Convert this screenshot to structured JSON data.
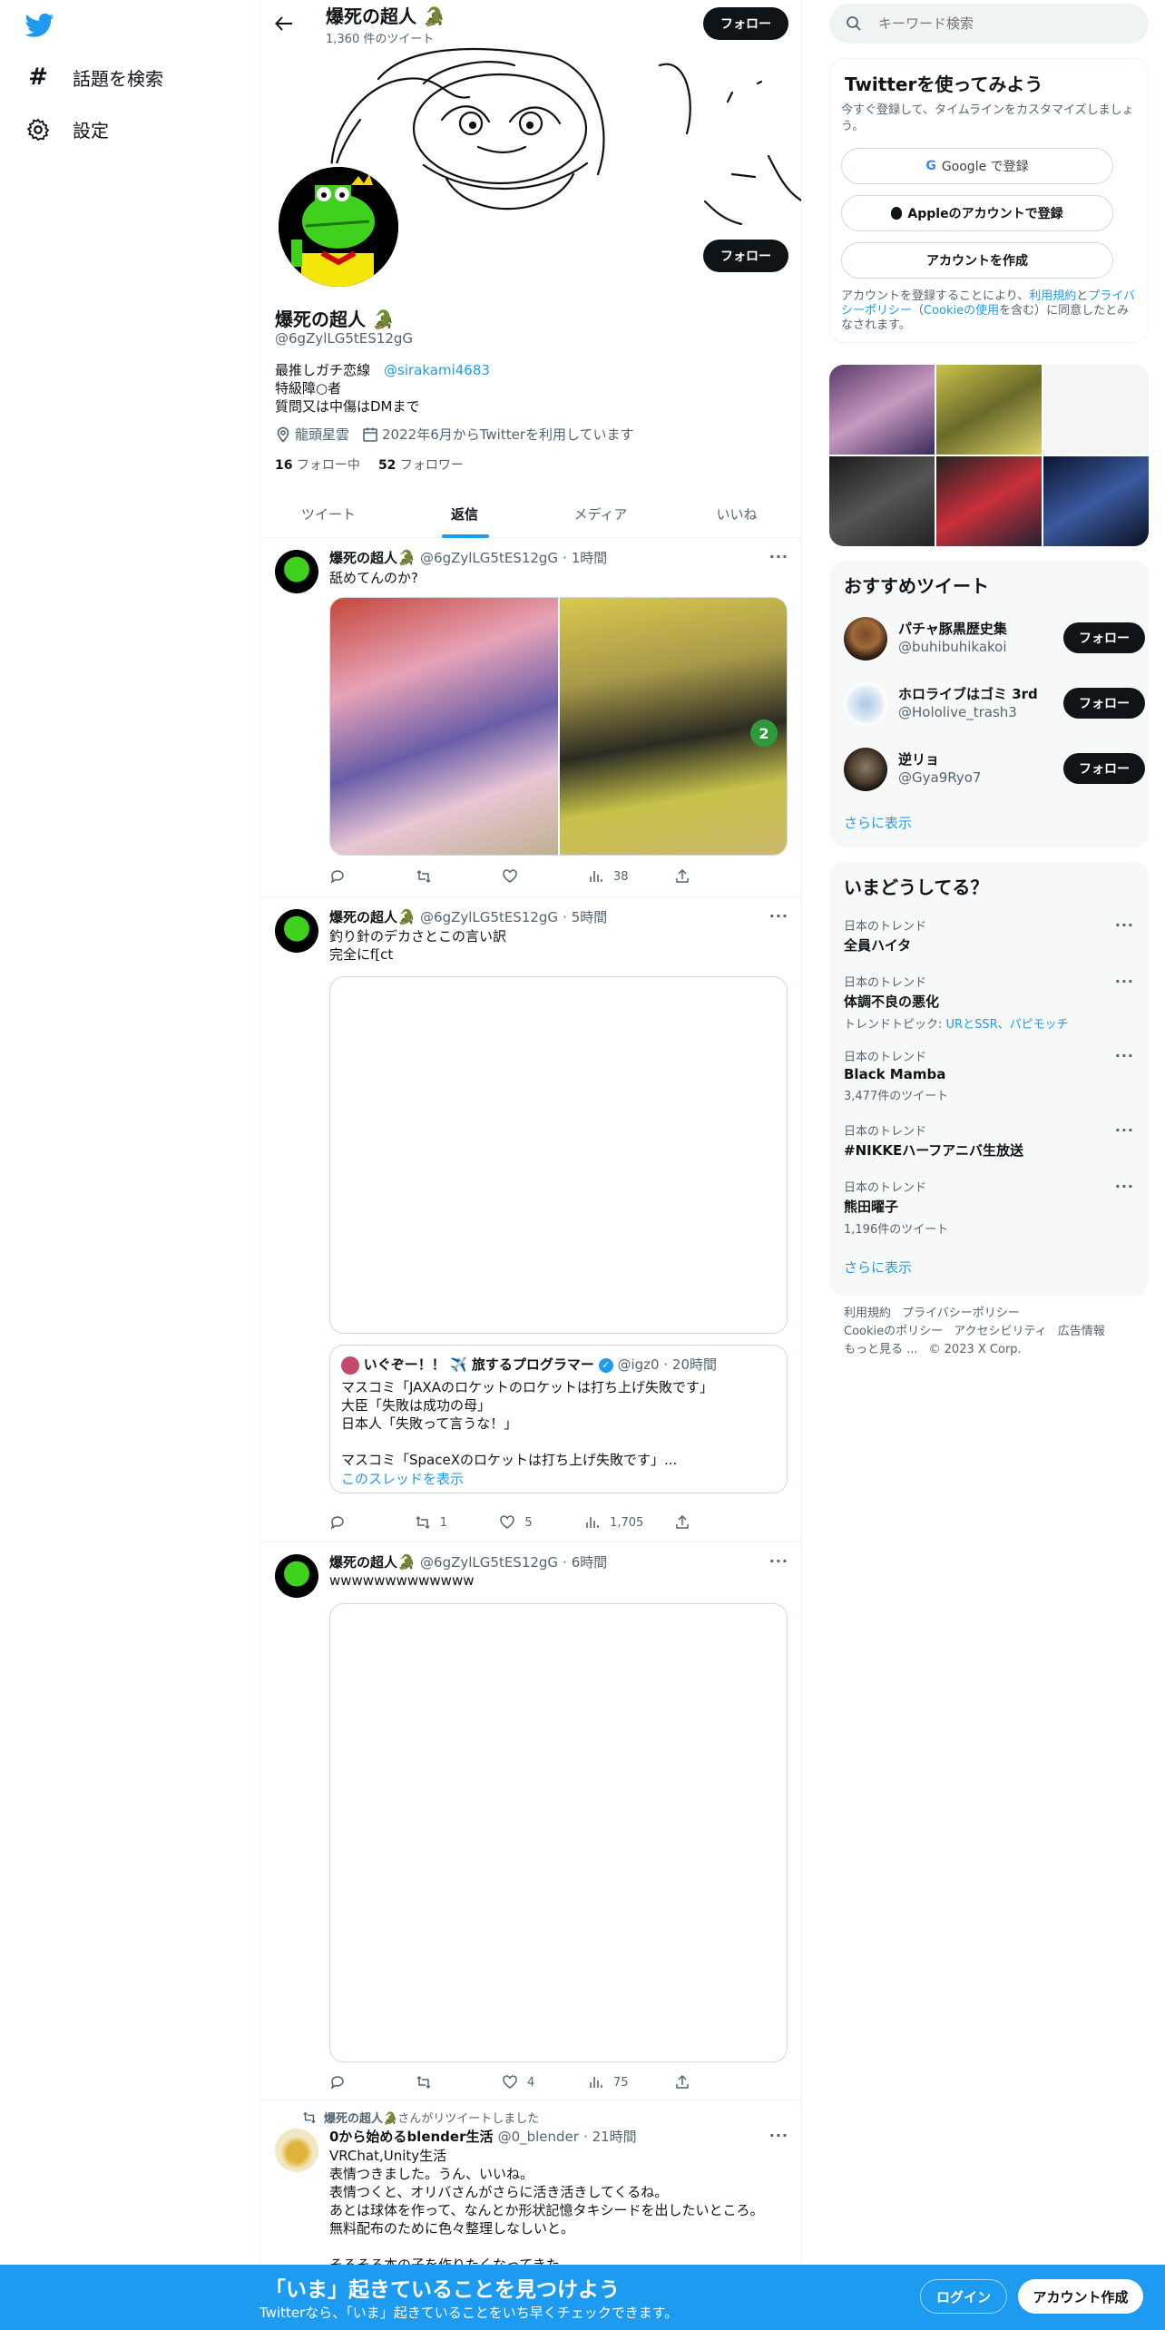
{
  "nav": {
    "search_label": "話題を検索",
    "settings_label": "設定"
  },
  "header": {
    "title": "爆死の超人",
    "tweet_count": "1,360 件のツイート",
    "follow_label": "フォロー"
  },
  "profile": {
    "name": "爆死の超人",
    "handle": "@6gZylLG5tES12gG",
    "follow_label": "フォロー",
    "bio_line1": "最推しガチ恋線",
    "bio_mention": "@sirakami4683",
    "bio_line2": "特級障○者",
    "bio_line3": "質問又は中傷はDMまで",
    "location": "龍頭星雲",
    "joined": "2022年6月からTwitterを利用しています",
    "following_count": "16",
    "following_label": "フォロー中",
    "followers_count": "52",
    "followers_label": "フォロワー"
  },
  "tabs": [
    {
      "label": "ツイート"
    },
    {
      "label": "返信"
    },
    {
      "label": "メディア"
    },
    {
      "label": "いいね"
    }
  ],
  "tweets": [
    {
      "name": "爆死の超人",
      "handle": "@6gZylLG5tES12gG",
      "time": "· 1時間",
      "text": "舐めてんのか?",
      "views": "38",
      "replies": "",
      "retweets": "",
      "likes": ""
    },
    {
      "name": "爆死の超人",
      "handle": "@6gZylLG5tES12gG",
      "time": "· 5時間",
      "text1": "釣り針のデカさとこの言い訳",
      "text2": "完全にf[ct",
      "quote": {
        "name": "いぐぞー！！ ✈️ 旅するプログラマー",
        "handle": "@igz0",
        "time": "· 20時間",
        "l1": "マスコミ「JAXAのロケットのロケットは打ち上げ失敗です」",
        "l2": "大臣「失敗は成功の母」",
        "l3": "日本人「失敗って言うな！」",
        "l4": "マスコミ「SpaceXのロケットは打ち上げ失敗です」...",
        "thread": "このスレッドを表示"
      },
      "retweets": "1",
      "likes": "5",
      "views": "1,705"
    },
    {
      "name": "爆死の超人",
      "handle": "@6gZylLG5tES12gG",
      "time": "· 6時間",
      "text": "wwwwwwwwwwwww",
      "likes": "4",
      "views": "75"
    },
    {
      "retweeted_by": "爆死の超人",
      "retweeted_suffix": "さんがリツイートしました",
      "name": "0から始めるblender生活",
      "handle": "@0_blender",
      "time": "· 21時間",
      "l1": "VRChat,Unity生活",
      "l2": "表情つきました。うん、いいね。",
      "l3": "表情つくと、オリバさんがさらに活き活きしてくるね。",
      "l4": "あとは球体を作って、なんとか形状記憶タキシードを出したいところ。",
      "l5": "無料配布のために色々整理しなしいと。",
      "l6": "そろそろ本の子を作りたくなってきた"
    }
  ],
  "search": {
    "placeholder": "キーワード検索"
  },
  "signup": {
    "title": "Twitterを使ってみよう",
    "subtitle": "今すぐ登録して、タイムラインをカスタマイズしましょう。",
    "google": "Google で登録",
    "apple": "Appleのアカウントで登録",
    "create": "アカウントを作成",
    "legal_1": "アカウントを登録することにより、",
    "legal_terms": "利用規約",
    "legal_and": "と",
    "legal_privacy": "プライバシーポリシー",
    "legal_open": "（",
    "legal_cookie": "Cookieの使用",
    "legal_2": "を含む）に同意したとみなされます。"
  },
  "recommend": {
    "title": "おすすめツイート",
    "more": "さらに表示",
    "users": [
      {
        "name": "パチャ豚黒歴史集",
        "handle": "@buhibuhikakoi",
        "follow": "フォロー"
      },
      {
        "name": "ホロライブはゴミ 3rd",
        "handle": "@Hololive_trash3",
        "follow": "フォロー"
      },
      {
        "name": "逆リョ",
        "handle": "@Gya9Ryo7",
        "follow": "フォロー"
      }
    ]
  },
  "trends": {
    "title": "いまどうしてる？",
    "more": "さらに表示",
    "items": [
      {
        "cat": "日本のトレンド",
        "name": "全員ハイタ",
        "meta": ""
      },
      {
        "cat": "日本のトレンド",
        "name": "体調不良の悪化",
        "meta_prefix": "トレンドトピック: ",
        "meta_links": "URとSSR、パピモッチ"
      },
      {
        "cat": "日本のトレンド",
        "name": "Black Mamba",
        "meta": "3,477件のツイート"
      },
      {
        "cat": "日本のトレンド",
        "name": "#NIKKEハーフアニバ生放送",
        "meta": ""
      },
      {
        "cat": "日本のトレンド",
        "name": "熊田曜子",
        "meta": "1,196件のツイート"
      }
    ]
  },
  "footer": {
    "terms": "利用規約",
    "privacy": "プライバシーポリシー",
    "cookie": "Cookieのポリシー",
    "access": "アクセシビリティ",
    "ads": "広告情報",
    "more": "もっと見る ...",
    "copy": "© 2023 X Corp."
  },
  "banner": {
    "title": "「いま」起きていることを見つけよう",
    "subtitle": "Twitterなら、「いま」起きていることをいち早くチェックできます。",
    "login": "ログイン",
    "signup": "アカウント作成"
  },
  "colors": {
    "accent": "#1d9bf0",
    "dark": "#0f1419",
    "banner": "#1d9bf0"
  }
}
